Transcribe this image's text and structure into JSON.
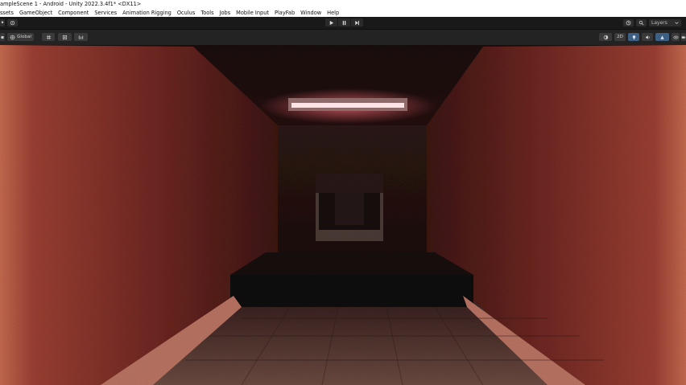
{
  "window": {
    "title": "ampleScene 1 - Android - Unity 2022.3.4f1* <DX11>"
  },
  "menu": {
    "items": [
      "ssets",
      "GameObject",
      "Component",
      "Services",
      "Animation Rigging",
      "Oculus",
      "Tools",
      "Jobs",
      "Mobile Input",
      "PlayFab",
      "Window",
      "Help"
    ]
  },
  "toolbar": {
    "layers_label": "Layers",
    "icons": [
      "cloud-icon",
      "history-icon",
      "search-icon"
    ]
  },
  "scene_toolbar": {
    "global_label": "Global",
    "mode_2d_label": "2D",
    "icons": [
      "grid-icon",
      "snap-icon",
      "view-options-icon",
      "shading-icon",
      "light-icon",
      "audio-icon",
      "effects-icon",
      "camera-icon"
    ]
  },
  "colors": {
    "wall": "#8a3b2e",
    "ceiling_light": "#ffd7dc",
    "accent_blue": "#3d5f84"
  }
}
